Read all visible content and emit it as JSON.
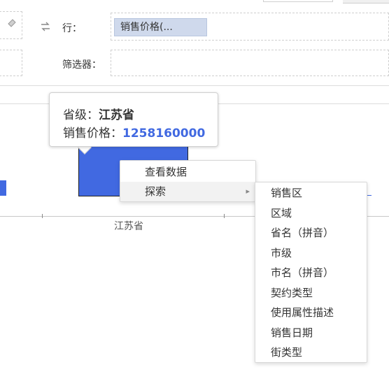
{
  "shelves": {
    "row_label": "行：",
    "row_pill": "销售价格(...",
    "filter_label": "筛选器："
  },
  "chart_data": {
    "type": "bar",
    "categories": [
      "江苏省"
    ],
    "series": [
      {
        "values": [
          1258160000
        ]
      }
    ],
    "xlabel": "",
    "ylabel": "",
    "colors": {
      "bar": "#4169e1"
    }
  },
  "chart": {
    "x_tick_label": "江苏省"
  },
  "tooltip": {
    "province_label": "省级：",
    "province_value": "江苏省",
    "price_label": "销售价格：",
    "price_value": "1258160000"
  },
  "context_menu": {
    "items": [
      "查看数据",
      "探索"
    ]
  },
  "explore_submenu": {
    "items": [
      "销售区",
      "区域",
      "省名（拼音）",
      "市级",
      "市名（拼音）",
      "契约类型",
      "使用属性描述",
      "销售日期",
      "街类型"
    ]
  },
  "colors": {
    "accent": "#4169e1",
    "pill_bg": "#cfd9ec"
  }
}
